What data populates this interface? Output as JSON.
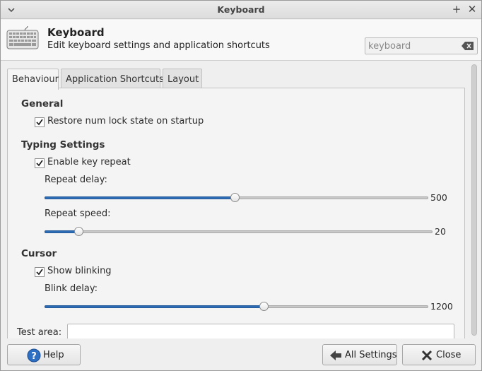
{
  "window": {
    "title": "Keyboard"
  },
  "header": {
    "title": "Keyboard",
    "subtitle": "Edit keyboard settings and application shortcuts",
    "search_value": "keyboard"
  },
  "tabs": [
    {
      "label": "Behaviour",
      "active": true
    },
    {
      "label": "Application Shortcuts",
      "active": false
    },
    {
      "label": "Layout",
      "active": false
    }
  ],
  "general": {
    "title": "General",
    "numlock": {
      "label": "Restore num lock state on startup",
      "checked": true
    }
  },
  "typing": {
    "title": "Typing Settings",
    "repeat": {
      "label": "Enable key repeat",
      "checked": true
    },
    "repeat_delay": {
      "label": "Repeat delay:",
      "value": "500",
      "fraction": 0.496
    },
    "repeat_speed": {
      "label": "Repeat speed:",
      "value": "20",
      "fraction": 0.088
    }
  },
  "cursor": {
    "title": "Cursor",
    "blinking": {
      "label": "Show blinking",
      "checked": true
    },
    "blink_delay": {
      "label": "Blink delay:",
      "value": "1200",
      "fraction": 0.57
    }
  },
  "test_area": {
    "label": "Test area:",
    "value": ""
  },
  "buttons": {
    "help": "Help",
    "all_settings": "All Settings",
    "close": "Close"
  },
  "colors": {
    "accent": "#2e6bb5",
    "help_icon": "#2d6fc2"
  }
}
